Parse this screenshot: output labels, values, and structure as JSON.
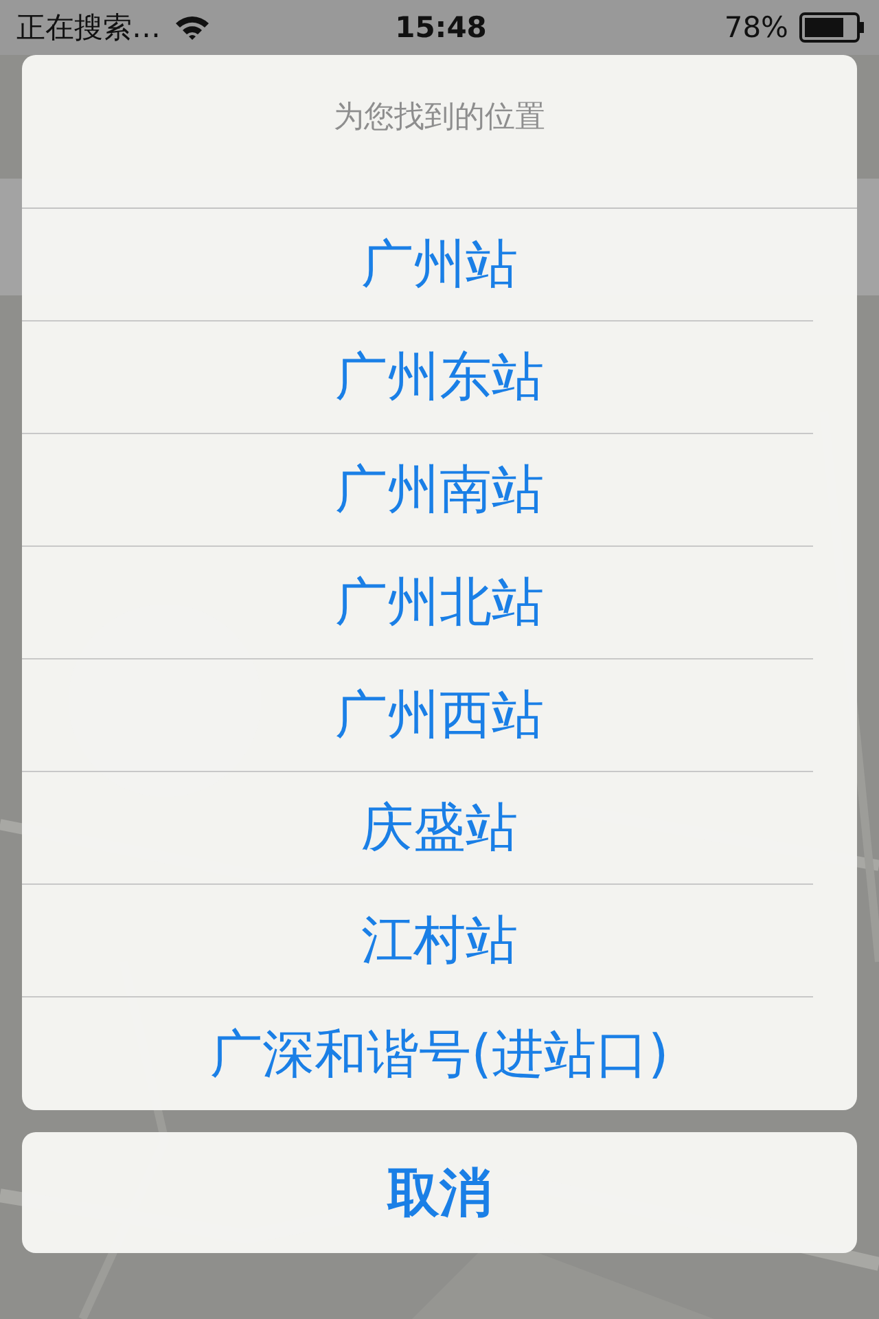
{
  "status_bar": {
    "carrier": "正在搜索…",
    "time": "15:48",
    "battery": "78%"
  },
  "action_sheet": {
    "title": "为您找到的位置",
    "items": [
      "广州站",
      "广州东站",
      "广州南站",
      "广州北站",
      "广州西站",
      "庆盛站",
      "江村站",
      "广深和谐号(进站口)"
    ],
    "cancel": "取消"
  }
}
